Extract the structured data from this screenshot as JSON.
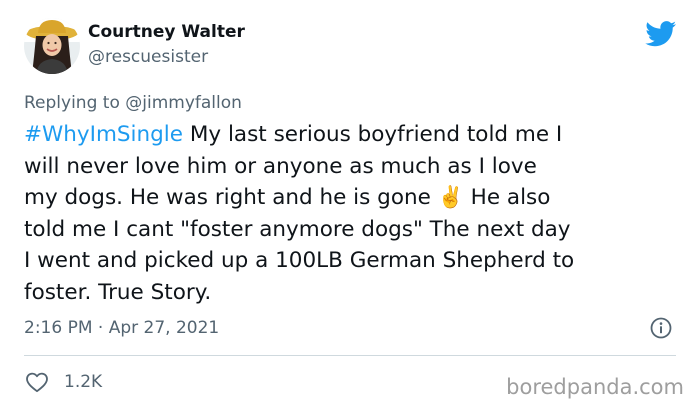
{
  "author": {
    "display_name": "Courtney Walter",
    "handle": "@rescuesister"
  },
  "reply": {
    "prefix": "Replying to ",
    "mention": "@jimmyfallon"
  },
  "tweet": {
    "lines": [
      {
        "hashtag": "#WhyImSingle",
        "text": " My last serious boyfriend told me I"
      },
      {
        "text": "will never love him or anyone as much as I love"
      },
      {
        "text": "my dogs. He was right and he is gone ",
        "emoji": "✌️",
        "after": " He also"
      },
      {
        "text": "told me I cant \"foster anymore dogs\" The next day"
      },
      {
        "text": "I went and picked up a 100LB German Shepherd to"
      },
      {
        "text": "foster. True Story."
      }
    ]
  },
  "meta": {
    "timestamp": "2:16 PM · Apr 27, 2021"
  },
  "actions": {
    "like_count": "1.2K"
  },
  "watermark": "boredpanda.com",
  "colors": {
    "hashtag": "#1d9bf0",
    "twitter_brand": "#1d9bf0",
    "secondary_text": "#536471"
  },
  "icons": {
    "brand": "twitter-bird-icon",
    "info": "info-icon",
    "like": "heart-icon"
  }
}
